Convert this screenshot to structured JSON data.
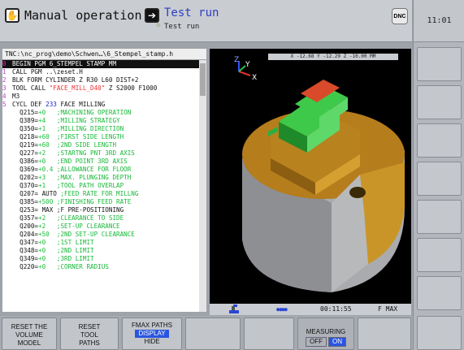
{
  "header": {
    "left_mode": "Manual operation",
    "right_mode": "Test run",
    "right_sub": "Test run",
    "dnc": "DNC",
    "clock": "11:01"
  },
  "program": {
    "path": "TNC:\\nc_prog\\demo\\Schwen…\\6_Stempel_stamp.h",
    "lines": [
      {
        "n": "0",
        "parts": [
          {
            "t": "BEGIN PGM 6_STEMPEL STAMP MM",
            "c": "txt"
          }
        ],
        "selected": true
      },
      {
        "n": "1",
        "parts": [
          {
            "t": "CALL PGM ..\\zeset.H",
            "c": "txt"
          }
        ]
      },
      {
        "n": "2",
        "parts": [
          {
            "t": "BLK FORM CYLINDER Z R30 L60 DIST+2",
            "c": "txt"
          }
        ]
      },
      {
        "n": "3",
        "parts": [
          {
            "t": "TOOL CALL ",
            "c": "txt"
          },
          {
            "t": "\"FACE_MILL_D40\"",
            "c": "str"
          },
          {
            "t": " Z S2000 F1000",
            "c": "txt"
          }
        ]
      },
      {
        "n": "4",
        "parts": [
          {
            "t": "M3",
            "c": "txt"
          }
        ]
      },
      {
        "n": "5",
        "parts": [
          {
            "t": "CYCL DEF ",
            "c": "txt"
          },
          {
            "t": "233",
            "c": "kw"
          },
          {
            "t": " FACE MILLING",
            "c": "txt"
          }
        ]
      },
      {
        "n": "",
        "parts": [
          {
            "t": "  Q215=",
            "c": "txt"
          },
          {
            "t": "+0   ",
            "c": "val"
          },
          {
            "t": ";MACHINING OPERATION",
            "c": "cmt"
          }
        ]
      },
      {
        "n": "",
        "parts": [
          {
            "t": "  Q389=",
            "c": "txt"
          },
          {
            "t": "+4   ",
            "c": "val"
          },
          {
            "t": ";MILLING STRATEGY",
            "c": "cmt"
          }
        ]
      },
      {
        "n": "",
        "parts": [
          {
            "t": "  Q350=",
            "c": "txt"
          },
          {
            "t": "+1   ",
            "c": "val"
          },
          {
            "t": ";MILLING DIRECTION",
            "c": "cmt"
          }
        ]
      },
      {
        "n": "",
        "parts": [
          {
            "t": "  Q218=",
            "c": "txt"
          },
          {
            "t": "+60  ",
            "c": "val"
          },
          {
            "t": ";FIRST SIDE LENGTH",
            "c": "cmt"
          }
        ]
      },
      {
        "n": "",
        "parts": [
          {
            "t": "  Q219=",
            "c": "txt"
          },
          {
            "t": "+60  ",
            "c": "val"
          },
          {
            "t": ";2ND SIDE LENGTH",
            "c": "cmt"
          }
        ]
      },
      {
        "n": "",
        "parts": [
          {
            "t": "  Q227=",
            "c": "txt"
          },
          {
            "t": "+2   ",
            "c": "val"
          },
          {
            "t": ";STARTNG PNT 3RD AXIS",
            "c": "cmt"
          }
        ]
      },
      {
        "n": "",
        "parts": [
          {
            "t": "  Q386=",
            "c": "txt"
          },
          {
            "t": "+0   ",
            "c": "val"
          },
          {
            "t": ";END POINT 3RD AXIS",
            "c": "cmt"
          }
        ]
      },
      {
        "n": "",
        "parts": [
          {
            "t": "  Q369=",
            "c": "txt"
          },
          {
            "t": "+0.4 ",
            "c": "val"
          },
          {
            "t": ";ALLOWANCE FOR FLOOR",
            "c": "cmt"
          }
        ]
      },
      {
        "n": "",
        "parts": [
          {
            "t": "  Q202=",
            "c": "txt"
          },
          {
            "t": "+3   ",
            "c": "val"
          },
          {
            "t": ";MAX. PLUNGING DEPTH",
            "c": "cmt"
          }
        ]
      },
      {
        "n": "",
        "parts": [
          {
            "t": "  Q370=",
            "c": "txt"
          },
          {
            "t": "+1   ",
            "c": "val"
          },
          {
            "t": ";TOOL PATH OVERLAP",
            "c": "cmt"
          }
        ]
      },
      {
        "n": "",
        "parts": [
          {
            "t": "  Q207= AUTO ",
            "c": "txt"
          },
          {
            "t": ";FEED RATE FOR MILLNG",
            "c": "cmt"
          }
        ]
      },
      {
        "n": "",
        "parts": [
          {
            "t": "  Q385=",
            "c": "txt"
          },
          {
            "t": "+500 ",
            "c": "val"
          },
          {
            "t": ";FINISHING FEED RATE",
            "c": "cmt"
          }
        ]
      },
      {
        "n": "",
        "parts": [
          {
            "t": "  Q253= MAX ",
            "c": "txt"
          },
          {
            "t": ";F PRE-POSITIONING",
            "c": "txt"
          }
        ]
      },
      {
        "n": "",
        "parts": [
          {
            "t": "  Q357=",
            "c": "txt"
          },
          {
            "t": "+2   ",
            "c": "val"
          },
          {
            "t": ";CLEARANCE TO SIDE",
            "c": "cmt"
          }
        ]
      },
      {
        "n": "",
        "parts": [
          {
            "t": "  Q200=",
            "c": "txt"
          },
          {
            "t": "+2   ",
            "c": "val"
          },
          {
            "t": ";SET-UP CLEARANCE",
            "c": "cmt"
          }
        ]
      },
      {
        "n": "",
        "parts": [
          {
            "t": "  Q204=",
            "c": "txt"
          },
          {
            "t": "+50  ",
            "c": "val"
          },
          {
            "t": ";2ND SET-UP CLEARANCE",
            "c": "cmt"
          }
        ]
      },
      {
        "n": "",
        "parts": [
          {
            "t": "  Q347=",
            "c": "txt"
          },
          {
            "t": "+0   ",
            "c": "val"
          },
          {
            "t": ";1ST LIMIT",
            "c": "cmt"
          }
        ]
      },
      {
        "n": "",
        "parts": [
          {
            "t": "  Q348=",
            "c": "txt"
          },
          {
            "t": "+0   ",
            "c": "val"
          },
          {
            "t": ";2ND LIMIT",
            "c": "cmt"
          }
        ]
      },
      {
        "n": "",
        "parts": [
          {
            "t": "  Q349=",
            "c": "txt"
          },
          {
            "t": "+0   ",
            "c": "val"
          },
          {
            "t": ";3RD LIMIT",
            "c": "cmt"
          }
        ]
      },
      {
        "n": "",
        "parts": [
          {
            "t": "  Q220=",
            "c": "txt"
          },
          {
            "t": "+0   ",
            "c": "val"
          },
          {
            "t": ";CORNER RADIUS",
            "c": "cmt"
          }
        ]
      }
    ]
  },
  "graphics": {
    "coords": "X   -12.68  Y   -12.29  Z   -10.00 MM",
    "axis_z": "Z",
    "axis_y": "Y",
    "axis_x": "X",
    "sim_time": "00:11:55",
    "feed": "F MAX",
    "progress": "●●●●"
  },
  "softkeys": {
    "k1": {
      "l1": "RESET THE",
      "l2": "VOLUME",
      "l3": "MODEL"
    },
    "k2": {
      "l1": "RESET",
      "l2": "TOOL",
      "l3": "PATHS"
    },
    "k3": {
      "l1": "FMAX PATHS",
      "l2": "DISPLAY",
      "l3": "HIDE"
    },
    "k7": {
      "l1": "MEASURING",
      "off": "OFF",
      "on": "ON"
    }
  },
  "colors": {
    "accent_blue": "#2a55e0",
    "value_green": "#1bbd3a",
    "block_purple": "#c23ec2"
  }
}
